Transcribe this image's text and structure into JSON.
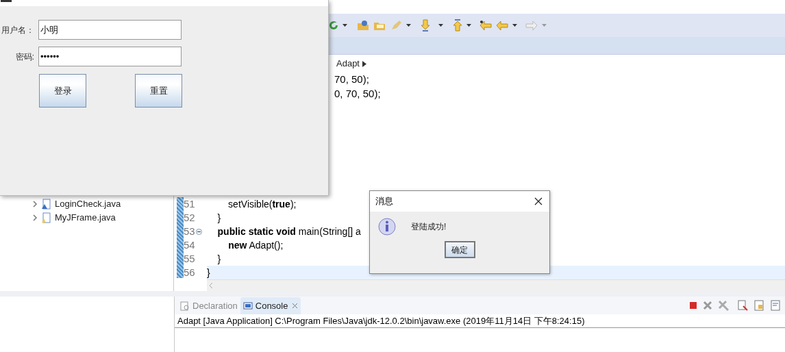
{
  "login_window": {
    "fields": [
      {
        "label": "用户名：",
        "value": "小明"
      },
      {
        "label": "密码:",
        "value": "••••••"
      }
    ],
    "buttons": [
      "登录",
      "重置"
    ]
  },
  "package_explorer": {
    "items": [
      {
        "label": "LoginCheck.java",
        "expanded": false,
        "kind": "class"
      },
      {
        "label": "MyJFrame.java",
        "expanded": false,
        "kind": "warning"
      }
    ]
  },
  "editor": {
    "breadcrumb": "Adapt",
    "partial_lines": [
      "70, 50);",
      "0, 70, 50);"
    ],
    "lines": [
      {
        "number": "51",
        "code": "        setVisible(**true**);",
        "foldable": false,
        "selected": false
      },
      {
        "number": "52",
        "code": "    }",
        "foldable": false,
        "selected": false
      },
      {
        "number": "53",
        "code": "    **public static void** main(String[] a",
        "foldable": true,
        "selected": false
      },
      {
        "number": "54",
        "code": "        **new** Adapt();",
        "foldable": false,
        "selected": false
      },
      {
        "number": "55",
        "code": "    }",
        "foldable": false,
        "selected": false
      },
      {
        "number": "56",
        "code": "}",
        "foldable": false,
        "selected": true
      }
    ]
  },
  "bottom_panel": {
    "tabs": [
      {
        "label": "Declaration",
        "selected": false
      },
      {
        "label": "Console",
        "selected": true
      }
    ],
    "console_header": "Adapt [Java Application] C:\\Program Files\\Java\\jdk-12.0.2\\bin\\javaw.exe (2019年11月14日 下午8:24:15)"
  },
  "dialog": {
    "title": "消息",
    "message": "登陆成功!",
    "button": "确定"
  }
}
